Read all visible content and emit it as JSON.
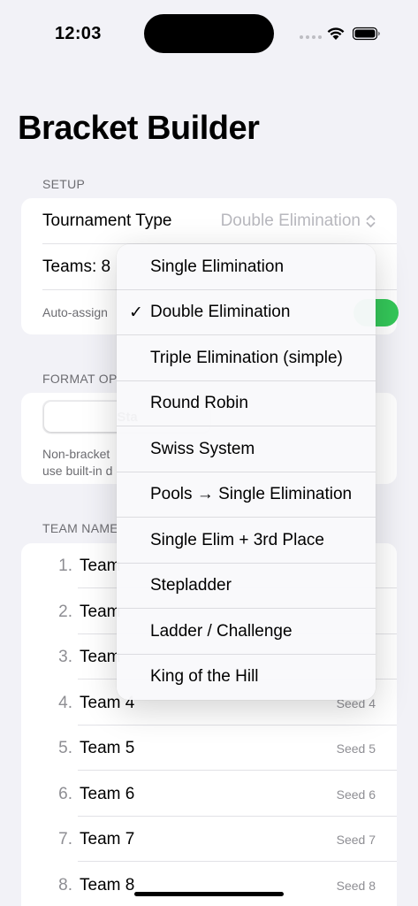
{
  "status": {
    "time": "12:03"
  },
  "title": "Bracket Builder",
  "setup": {
    "header": "SETUP",
    "tournament_type_label": "Tournament Type",
    "tournament_type_value": "Double Elimination",
    "teams_label": "Teams: 8",
    "auto_assign_label": "Auto-assign",
    "auto_assign_on": true
  },
  "format": {
    "header": "FORMAT OP",
    "segment_selected": "Sta",
    "note_line1": "Non-bracket",
    "note_line2": "use built-in d"
  },
  "teams_section": {
    "header": "TEAM NAME",
    "teams": [
      {
        "num": "1.",
        "name": "Team",
        "seed": ""
      },
      {
        "num": "2.",
        "name": "Team",
        "seed": ""
      },
      {
        "num": "3.",
        "name": "Team",
        "seed": ""
      },
      {
        "num": "4.",
        "name": "Team 4",
        "seed": "Seed 4"
      },
      {
        "num": "5.",
        "name": "Team 5",
        "seed": "Seed 5"
      },
      {
        "num": "6.",
        "name": "Team 6",
        "seed": "Seed 6"
      },
      {
        "num": "7.",
        "name": "Team 7",
        "seed": "Seed 7"
      },
      {
        "num": "8.",
        "name": "Team 8",
        "seed": "Seed 8"
      }
    ]
  },
  "menu": {
    "selected_index": 1,
    "check_glyph": "✓",
    "items": [
      "Single Elimination",
      "Double Elimination",
      "Triple Elimination (simple)",
      "Round Robin",
      "Swiss System",
      "Pools → Single Elimination",
      "Single Elim + 3rd Place",
      "Stepladder",
      "Ladder / Challenge",
      "King of the Hill"
    ]
  },
  "colors": {
    "accent_green": "#34C759",
    "background": "#F2F2F7"
  },
  "icons": [
    "wifi-icon",
    "battery-icon",
    "signal-icon",
    "chevron-up-down-icon",
    "checkmark-icon"
  ]
}
